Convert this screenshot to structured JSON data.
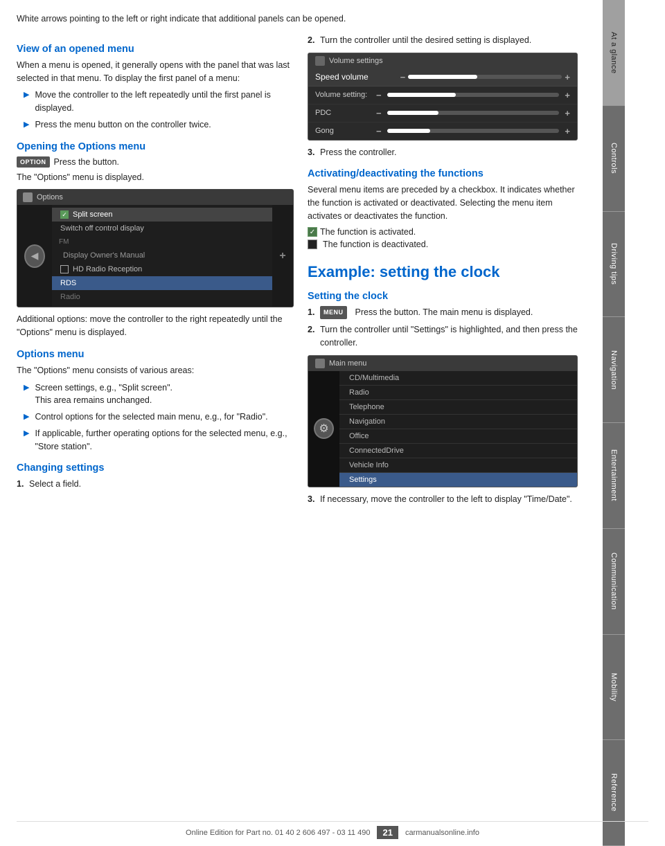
{
  "intro": {
    "text": "White arrows pointing to the left or right indicate that additional panels can be opened."
  },
  "section_opened_menu": {
    "title": "View of an opened menu",
    "body": "When a menu is opened, it generally opens with the panel that was last selected in that menu. To display the first panel of a menu:",
    "bullets": [
      "Move the controller to the left repeatedly until the first panel is displayed.",
      "Press the menu button on the controller twice."
    ]
  },
  "section_options_menu_opening": {
    "title": "Opening the Options menu",
    "option_label": "OPTION",
    "body1": "Press the button.",
    "body2": "The \"Options\" menu is displayed.",
    "additional_text": "Additional options: move the controller to the right repeatedly until the \"Options\" menu is displayed."
  },
  "section_options_menu": {
    "title": "Options menu",
    "body": "The \"Options\" menu consists of various areas:",
    "bullets": [
      {
        "text": "Screen settings, e.g., \"Split screen\".",
        "sub": "This area remains unchanged."
      },
      {
        "text": "Control options for the selected main menu, e.g., for \"Radio\"."
      },
      {
        "text": "If applicable, further operating options for the selected menu, e.g., \"Store station\"."
      }
    ]
  },
  "section_changing_settings": {
    "title": "Changing settings",
    "step1": "Select a field."
  },
  "options_screen": {
    "title": "Options",
    "items": [
      {
        "label": "Split screen",
        "type": "checked",
        "indent": false
      },
      {
        "label": "Switch off control display",
        "type": "plain",
        "indent": false
      },
      {
        "label": "FM",
        "type": "plain",
        "indent": false
      },
      {
        "label": "Display Owner's Manual",
        "type": "plain",
        "indent": true
      },
      {
        "label": "HD Radio Reception",
        "type": "checkbox",
        "checked": false,
        "indent": false
      },
      {
        "label": "RDS",
        "type": "highlighted",
        "indent": false
      },
      {
        "label": "Radio",
        "type": "plain",
        "indent": false
      }
    ]
  },
  "right_col": {
    "step2_text": "Turn the controller until the desired setting is displayed.",
    "step3_text": "Press the controller.",
    "vol_screen": {
      "title": "Volume settings",
      "speed_label": "Speed volume",
      "items": [
        {
          "label": "Volume setting:",
          "fill": 40
        },
        {
          "label": "PDC",
          "fill": 30
        },
        {
          "label": "Gong",
          "fill": 25
        }
      ]
    },
    "section_activating": {
      "title": "Activating/deactivating the functions",
      "body": "Several menu items are preceded by a checkbox. It indicates whether the function is activated or deactivated. Selecting the menu item activates or deactivates the function.",
      "checked_text": "The function is activated.",
      "unchecked_text": "The function is deactivated."
    }
  },
  "example_section": {
    "title": "Example: setting the clock",
    "subtitle": "Setting the clock",
    "step1": {
      "num": "1.",
      "text": "Press the button. The main menu is displayed."
    },
    "step2": {
      "num": "2.",
      "text": "Turn the controller until \"Settings\" is highlighted, and then press the controller."
    },
    "step3": {
      "num": "3.",
      "text": "If necessary, move the controller to the left to display \"Time/Date\"."
    },
    "menu_label": "MENU",
    "main_menu_screen": {
      "title": "Main menu",
      "items": [
        "CD/Multimedia",
        "Radio",
        "Telephone",
        "Navigation",
        "Office",
        "ConnectedDrive",
        "Vehicle Info",
        "Settings"
      ]
    }
  },
  "sidebar": {
    "tabs": [
      {
        "label": "At a glance",
        "active": false
      },
      {
        "label": "Controls",
        "active": false
      },
      {
        "label": "Driving tips",
        "active": false
      },
      {
        "label": "Navigation",
        "active": false
      },
      {
        "label": "Entertainment",
        "active": false
      },
      {
        "label": "Communication",
        "active": false
      },
      {
        "label": "Mobility",
        "active": false
      },
      {
        "label": "Reference",
        "active": false
      }
    ]
  },
  "footer": {
    "text_left": "Online Edition for Part no. 01 40 2 606 497 - 03 11 490",
    "page_number": "21",
    "text_right": "carmanualsonline.info"
  }
}
